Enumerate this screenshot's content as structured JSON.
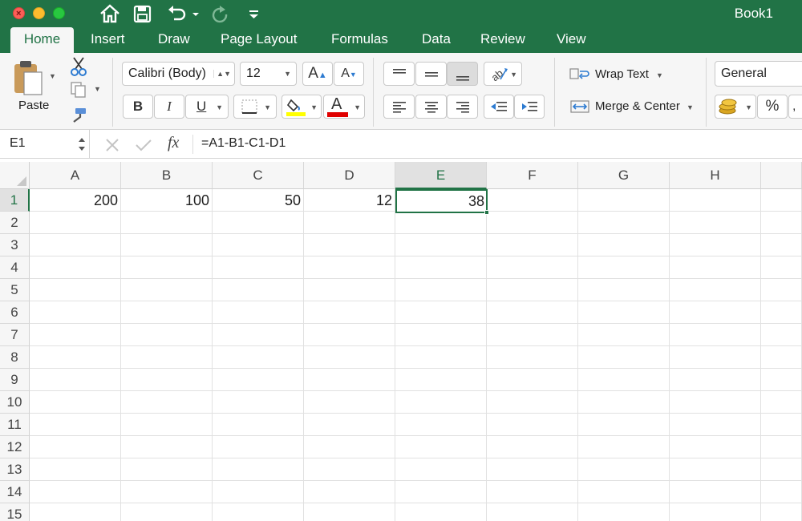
{
  "window": {
    "title": "Book1"
  },
  "quick_access": {
    "icons": [
      "home-icon",
      "save-icon",
      "undo-icon",
      "redo-icon",
      "customize-icon"
    ]
  },
  "tabs": [
    {
      "label": "Home",
      "active": true
    },
    {
      "label": "Insert",
      "active": false
    },
    {
      "label": "Draw",
      "active": false
    },
    {
      "label": "Page Layout",
      "active": false
    },
    {
      "label": "Formulas",
      "active": false
    },
    {
      "label": "Data",
      "active": false
    },
    {
      "label": "Review",
      "active": false
    },
    {
      "label": "View",
      "active": false
    }
  ],
  "ribbon": {
    "paste_label": "Paste",
    "font_name": "Calibri (Body)",
    "font_size": "12",
    "bold": "B",
    "italic": "I",
    "underline": "U",
    "font_color_glyph": "A",
    "wrap_text": "Wrap Text",
    "merge_center": "Merge & Center",
    "number_format": "General",
    "percent": "%",
    "highlight_color": "#ffff00",
    "font_color": "#e00000"
  },
  "formula_bar": {
    "name_box": "E1",
    "fx": "fx",
    "formula": "=A1-B1-C1-D1"
  },
  "sheet": {
    "columns": [
      "A",
      "B",
      "C",
      "D",
      "E",
      "F",
      "G",
      "H"
    ],
    "rows": [
      "1",
      "2",
      "3",
      "4",
      "5",
      "6",
      "7",
      "8",
      "9",
      "10",
      "11",
      "12",
      "13",
      "14",
      "15"
    ],
    "selected_column": "E",
    "selected_row": "1",
    "cells": {
      "A1": "200",
      "B1": "100",
      "C1": "50",
      "D1": "12",
      "E1": "38"
    }
  },
  "colors": {
    "accent": "#217346"
  }
}
